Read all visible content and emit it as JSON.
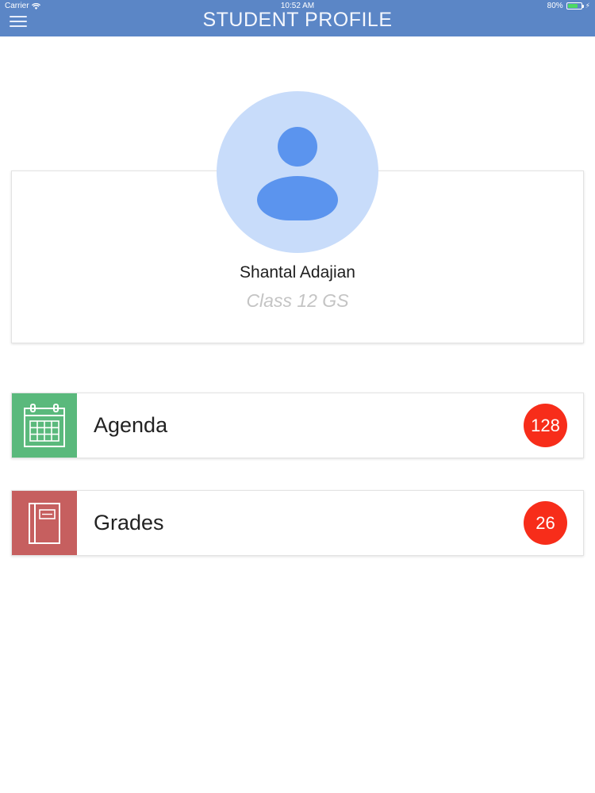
{
  "status_bar": {
    "carrier": "Carrier",
    "time": "10:52 AM",
    "battery_percent": "80%",
    "battery_level": 0.8
  },
  "header": {
    "title": "STUDENT PROFILE",
    "menu_icon": "hamburger-menu-icon",
    "background_color": "#5b86c6"
  },
  "profile": {
    "avatar_icon": "person-icon",
    "name": "Shantal Adajian",
    "class": "Class 12 GS"
  },
  "menu": {
    "items": [
      {
        "label": "Agenda",
        "count": "128",
        "icon": "calendar-icon",
        "color": "#5ab97c"
      },
      {
        "label": "Grades",
        "count": "26",
        "icon": "notebook-icon",
        "color": "#c65f5f"
      }
    ],
    "badge_color": "#f72d1a"
  }
}
